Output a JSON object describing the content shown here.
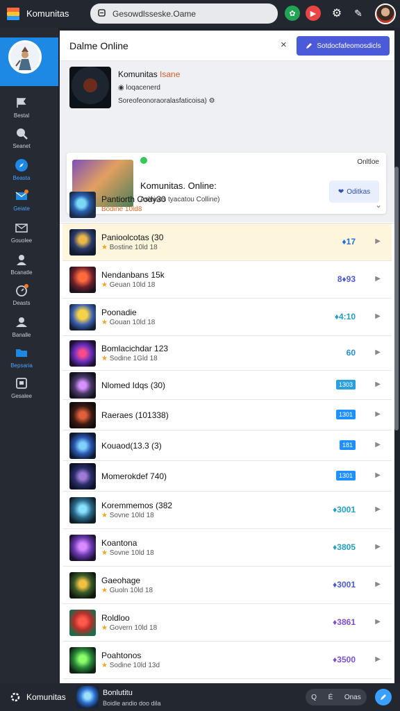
{
  "app": {
    "title": "Komunitas"
  },
  "search": {
    "value": "Gesowdlsseske.Oame"
  },
  "topbar": {
    "icons": [
      "leaf-icon",
      "play-icon",
      "gear-icon",
      "share-icon"
    ]
  },
  "sidebar": {
    "items": [
      {
        "icon": "flag-icon",
        "label": "Bestal"
      },
      {
        "icon": "search-icon",
        "label": "Seanet"
      },
      {
        "icon": "compass-icon",
        "label": "Beasta"
      },
      {
        "icon": "mail-icon",
        "label": "Geiate"
      },
      {
        "icon": "envelope-icon",
        "label": "Gouolee"
      },
      {
        "icon": "user-icon",
        "label": "Bcanatle"
      },
      {
        "icon": "clock-icon",
        "label": "Deasts"
      },
      {
        "icon": "group-icon",
        "label": "Banalle"
      },
      {
        "icon": "folder-icon",
        "label": "Bepsaria"
      },
      {
        "icon": "calendar-icon",
        "label": "Gesalee"
      }
    ]
  },
  "panel": {
    "title": "Dalme Online",
    "close_label": "×",
    "primary_button": "Sotdocfafeomosdicls"
  },
  "feature": {
    "title_main": "Komunitas ",
    "title_accent": "Isane",
    "meta": "loqacenerd",
    "sub": "Soreofeonoraoralasfaticoisa)"
  },
  "card": {
    "status": "Onltloe",
    "title": "Komunitas. Online:",
    "subtitle": "Asleises tyacatou Colline)",
    "button": "Oditkas"
  },
  "group": {
    "name": "Pantiorth Cody30",
    "sub": "Bodine 10ld8"
  },
  "rows": [
    {
      "name": "Panioolcotas (30",
      "rating": "Bostine 10ld 18",
      "count": "♦17",
      "color": "#1f6fe8",
      "badge": false,
      "highlight": true
    },
    {
      "name": "Nendanbans 15k",
      "rating": "Geuan 10ld 18",
      "count": "8♦93",
      "color": "#4a5ad8",
      "badge": false,
      "highlight": false
    },
    {
      "name": "Poonadie",
      "rating": "Gouan 10ld 18",
      "count": "♦4:10",
      "color": "#1fa0c8",
      "badge": false,
      "highlight": false
    },
    {
      "name": "Bomlacichdar 123",
      "rating": "Sodine 1Gld 18",
      "count": "60",
      "color": "#1f8fd8",
      "badge": false,
      "highlight": false
    },
    {
      "name": "Nlomed Idqs (30)",
      "rating": "",
      "count": "1303",
      "color": "#2aa0e0",
      "badge": true,
      "highlight": false
    },
    {
      "name": "Raeraes (101338)",
      "rating": "",
      "count": "1301",
      "color": "#1e90ff",
      "badge": true,
      "highlight": false
    },
    {
      "name": "Kouaod(13.3 (3)",
      "rating": "",
      "count": "181",
      "color": "#1e90ff",
      "badge": true,
      "highlight": false
    },
    {
      "name": "Momerokdef 740)",
      "rating": "",
      "count": "1301",
      "color": "#1e90ff",
      "badge": true,
      "highlight": false
    },
    {
      "name": "Koremmemos (382",
      "rating": "Sovne 10ld 18",
      "count": "♦3001",
      "color": "#1fa0c8",
      "badge": false,
      "highlight": false
    },
    {
      "name": "Koantona",
      "rating": "Sovne 10ld 18",
      "count": "♦3805",
      "color": "#1fa0c8",
      "badge": false,
      "highlight": false
    },
    {
      "name": "Gaeohage",
      "rating": "Guoln 10ld 18",
      "count": "♦3001",
      "color": "#4a5ad8",
      "badge": false,
      "highlight": false
    },
    {
      "name": "Roldloo",
      "rating": "Govern 10ld 18",
      "count": "♦3861",
      "color": "#7b4fd8",
      "badge": false,
      "highlight": false
    },
    {
      "name": "Poahtonos",
      "rating": "Sodine 10ld 13d",
      "count": "♦3500",
      "color": "#7b4fd8",
      "badge": false,
      "highlight": false
    }
  ],
  "bottombar": {
    "title": "Komunitas",
    "now_name": "Bonlutitu",
    "now_sub": "Boidle andio doo dila",
    "controls": [
      "Q",
      "É",
      "Onas"
    ]
  }
}
